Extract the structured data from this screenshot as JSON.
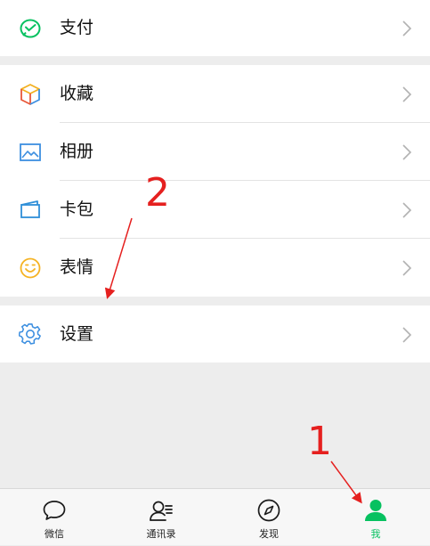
{
  "menu_top": {
    "items": [
      {
        "label": "支付",
        "icon": "wechat-pay-icon"
      }
    ]
  },
  "menu_middle": {
    "items": [
      {
        "label": "收藏",
        "icon": "favorites-cube-icon"
      },
      {
        "label": "相册",
        "icon": "album-picture-icon"
      },
      {
        "label": "卡包",
        "icon": "card-wallet-icon"
      },
      {
        "label": "表情",
        "icon": "smiley-icon"
      }
    ]
  },
  "menu_bottom": {
    "items": [
      {
        "label": "设置",
        "icon": "gear-icon"
      }
    ]
  },
  "tabbar": {
    "tabs": [
      {
        "label": "微信",
        "icon": "chat-bubble-icon"
      },
      {
        "label": "通讯录",
        "icon": "contacts-icon"
      },
      {
        "label": "发现",
        "icon": "compass-icon"
      },
      {
        "label": "我",
        "icon": "person-icon",
        "active": true
      }
    ]
  },
  "annotations": {
    "marker_1": "1",
    "marker_2": "2"
  },
  "colors": {
    "accent_green": "#07c160",
    "annotation_red": "#e5201f",
    "background": "#ededed"
  }
}
